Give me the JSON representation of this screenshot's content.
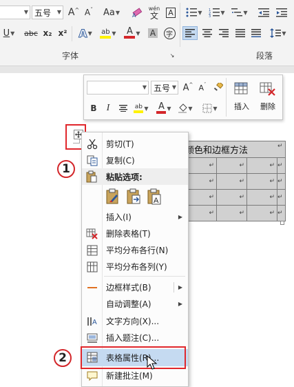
{
  "ribbon": {
    "font_size_value": "五号",
    "grow_font_label": "A",
    "shrink_font_label": "A",
    "change_case_label": "Aa",
    "phonetic_label": "wén",
    "phonetic_char": "文",
    "char_border_label": "A",
    "strike_label": "abc",
    "subscript_label": "x₂",
    "superscript_label": "x²",
    "text_effect_label": "A",
    "highlight_label": "ab",
    "font_color_label": "A",
    "char_shade_label": "A",
    "enclose_label": "字",
    "group_font_label": "字体",
    "group_paragraph_label": "段落",
    "colors": {
      "font_red": "#d4262a",
      "highlight_yellow": "#fff200",
      "accent_blue": "#2b579a"
    }
  },
  "mini_toolbar": {
    "font_name_value": "",
    "font_size_value": "五号",
    "grow_font_label": "A",
    "shrink_font_label": "A",
    "bold_label": "B",
    "italic_label": "I",
    "font_color_label": "A",
    "insert_label": "插入",
    "delete_label": "删除"
  },
  "document": {
    "table_header_text": "颜色和边框方法",
    "cell_mark": "↵"
  },
  "context_menu": {
    "items": [
      {
        "label": "剪切(T)",
        "icon": "scissors-icon"
      },
      {
        "label": "复制(C)",
        "icon": "copy-icon"
      },
      {
        "label": "粘贴选项:",
        "icon": "paste-icon"
      },
      {
        "label": "插入(I)",
        "icon": ""
      },
      {
        "label": "删除表格(T)",
        "icon": "delete-table-icon"
      },
      {
        "label": "平均分布各行(N)",
        "icon": "distribute-rows-icon"
      },
      {
        "label": "平均分布各列(Y)",
        "icon": "distribute-columns-icon"
      },
      {
        "label": "边框样式(B)",
        "icon": "border-style-icon"
      },
      {
        "label": "自动调整(A)",
        "icon": ""
      },
      {
        "label": "文字方向(X)...",
        "icon": "text-direction-icon"
      },
      {
        "label": "插入题注(C)...",
        "icon": "insert-caption-icon"
      },
      {
        "label": "表格属性(R)...",
        "icon": "table-properties-icon"
      },
      {
        "label": "新建批注(M)",
        "icon": "new-comment-icon"
      }
    ]
  },
  "callouts": {
    "one": "1",
    "two": "2"
  }
}
